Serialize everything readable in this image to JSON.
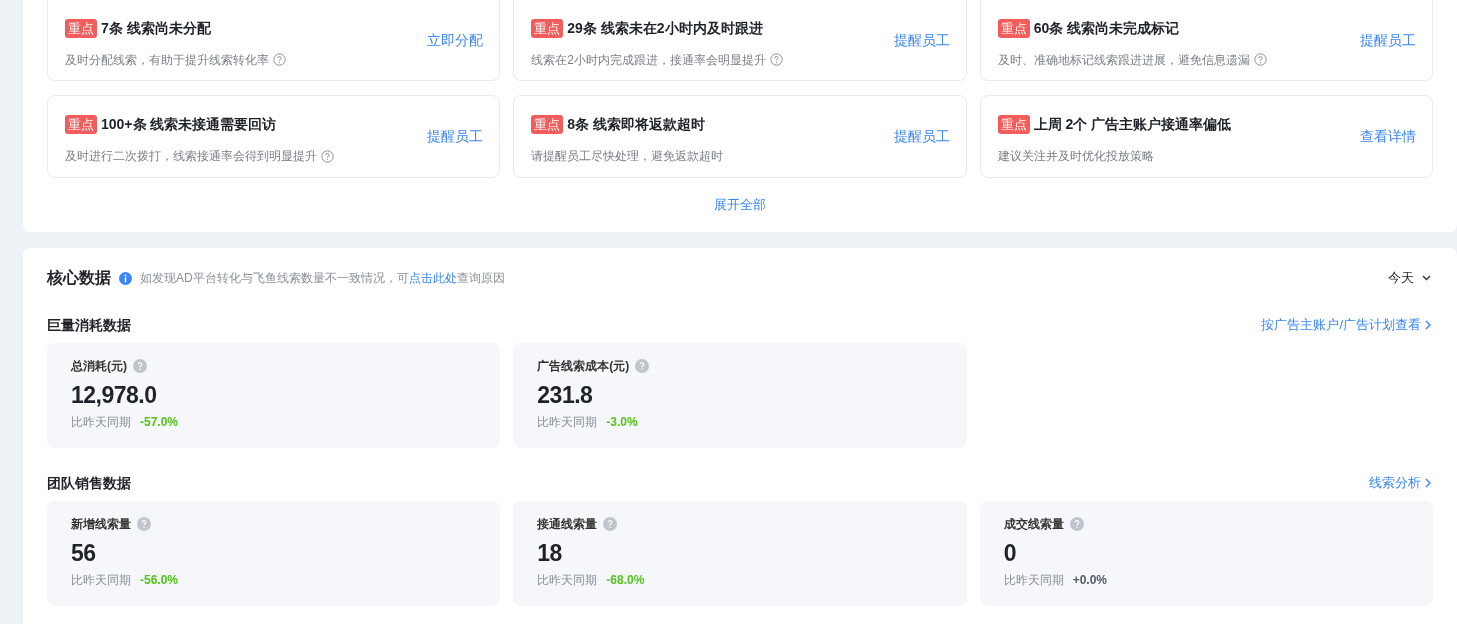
{
  "alerts": [
    {
      "badge": "重点",
      "title": "7条 线索尚未分配",
      "desc": "及时分配线索，有助于提升线索转化率",
      "help": true,
      "action": "立即分配"
    },
    {
      "badge": "重点",
      "title": "29条 线索未在2小时内及时跟进",
      "desc": "线索在2小时内完成跟进，接通率会明显提升",
      "help": true,
      "action": "提醒员工"
    },
    {
      "badge": "重点",
      "title": "60条 线索尚未完成标记",
      "desc": "及时、准确地标记线索跟进进展，避免信息遗漏",
      "help": true,
      "action": "提醒员工"
    },
    {
      "badge": "重点",
      "title": "100+条 线索未接通需要回访",
      "desc": "及时进行二次拨打，线索接通率会得到明显提升",
      "help": true,
      "action": "提醒员工"
    },
    {
      "badge": "重点",
      "title": "8条 线索即将返款超时",
      "desc": "请提醒员工尽快处理，避免返款超时",
      "help": false,
      "action": "提醒员工"
    },
    {
      "badge": "重点",
      "title": "上周 2个 广告主账户接通率偏低",
      "desc": "建议关注并及时优化投放策略",
      "help": false,
      "action": "查看详情"
    }
  ],
  "expand_all": "展开全部",
  "core": {
    "title": "核心数据",
    "notice_before": "如发现AD平台转化与飞鱼线索数量不一致情况，可",
    "notice_link": "点击此处",
    "notice_after": "查询原因",
    "period": "今天",
    "sections": [
      {
        "title": "巨量消耗数据",
        "link": "按广告主账户/广告计划查看",
        "metrics": [
          {
            "label": "总消耗(元)",
            "value": "12,978.0",
            "compare_label": "比昨天同期",
            "change": "-57.0%",
            "color": "#52c41a"
          },
          {
            "label": "广告线索成本(元)",
            "value": "231.8",
            "compare_label": "比昨天同期",
            "change": "-3.0%",
            "color": "#52c41a"
          }
        ]
      },
      {
        "title": "团队销售数据",
        "link": "线索分析",
        "metrics": [
          {
            "label": "新增线索量",
            "value": "56",
            "compare_label": "比昨天同期",
            "change": "-56.0%",
            "color": "#52c41a"
          },
          {
            "label": "接通线索量",
            "value": "18",
            "compare_label": "比昨天同期",
            "change": "-68.0%",
            "color": "#52c41a"
          },
          {
            "label": "成交线索量",
            "value": "0",
            "compare_label": "比昨天同期",
            "change": "+0.0%",
            "color": "#555b66"
          }
        ]
      }
    ]
  }
}
